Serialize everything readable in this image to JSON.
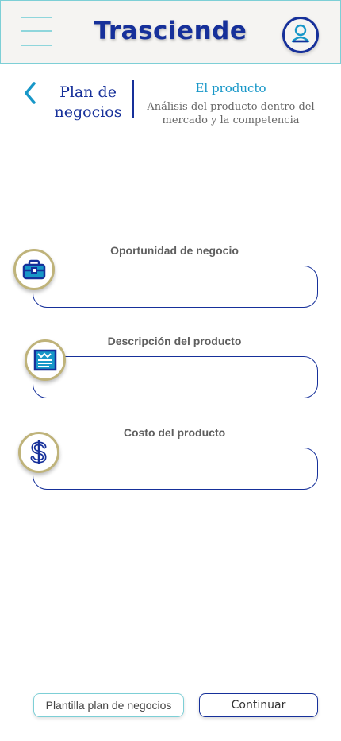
{
  "header": {
    "app_title": "Trasciende",
    "menu_icon": "menu-icon",
    "profile_icon": "user-icon"
  },
  "section": {
    "back_icon": "chevron-left-icon",
    "title": "Plan de negocios",
    "step_title": "El producto",
    "step_description": "Análisis del producto dentro del mercado y la competencia"
  },
  "fields": [
    {
      "label": "Oportunidad de negocio",
      "value": "",
      "icon": "briefcase-icon"
    },
    {
      "label": "Descripción del producto",
      "value": "",
      "icon": "document-icon"
    },
    {
      "label": "Costo del producto",
      "value": "",
      "icon": "dollar-icon"
    }
  ],
  "actions": {
    "template_label": "Plantilla plan de negocios",
    "continue_label": "Continuar"
  },
  "colors": {
    "primary": "#16309a",
    "accent": "#1797c8",
    "header_border": "#7dcfd6",
    "icon_ring": "#bfb37a"
  }
}
